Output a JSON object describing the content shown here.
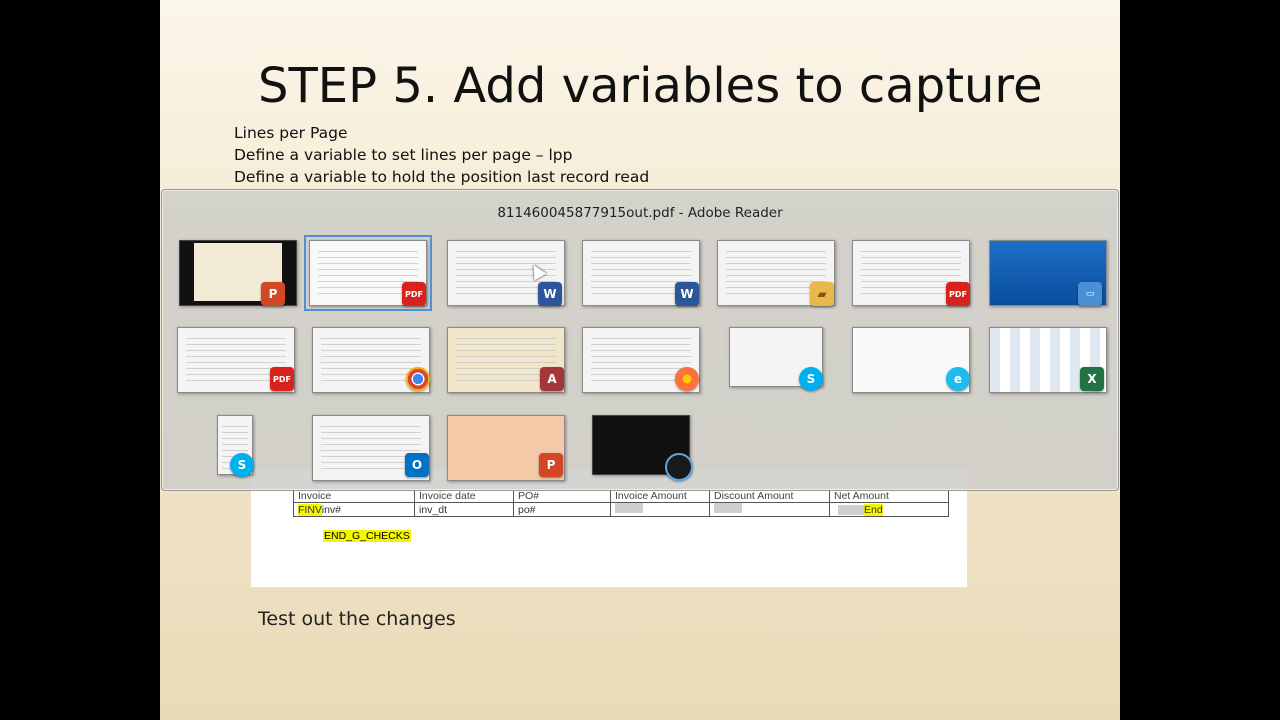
{
  "slide": {
    "title": "STEP 5. Add variables to capture",
    "bullets": [
      "Lines per Page",
      "Define a variable to set lines per page – lpp",
      "Define a variable to hold the position  last record read"
    ],
    "footer": "Test out the changes"
  },
  "document": {
    "headers": [
      "Invoice",
      "Invoice date",
      "PO#",
      "Invoice Amount",
      "Discount Amount",
      "Net Amount"
    ],
    "row": {
      "invoice_prefix": "FINV",
      "invoice_rest": "inv#",
      "invoice_date": "inv_dt",
      "po": "po#",
      "net_amount": "End"
    },
    "end_label": "END_G_CHECKS"
  },
  "switcher": {
    "title": "811460045877915out.pdf - Adobe Reader",
    "windows": [
      {
        "icon": "powerpoint-icon",
        "label": "P"
      },
      {
        "icon": "adobe-pdf-icon",
        "label": "PDF",
        "selected": true
      },
      {
        "icon": "word-icon",
        "label": "W"
      },
      {
        "icon": "word-icon",
        "label": "W"
      },
      {
        "icon": "folder-icon",
        "label": "▰"
      },
      {
        "icon": "adobe-pdf-icon",
        "label": "PDF"
      },
      {
        "icon": "desktop-icon",
        "label": "▭"
      },
      {
        "icon": "adobe-pdf-icon",
        "label": "PDF"
      },
      {
        "icon": "chrome-icon",
        "label": ""
      },
      {
        "icon": "access-icon",
        "label": "A"
      },
      {
        "icon": "firefox-icon",
        "label": ""
      },
      {
        "icon": "skype-icon",
        "label": "S"
      },
      {
        "icon": "internet-explorer-icon",
        "label": "e"
      },
      {
        "icon": "excel-icon",
        "label": "X"
      },
      {
        "icon": "skype-icon",
        "label": "S"
      },
      {
        "icon": "outlook-icon",
        "label": "O"
      },
      {
        "icon": "powerpoint-icon",
        "label": "P"
      },
      {
        "icon": "cortana-icon",
        "label": ""
      }
    ]
  },
  "colors": {
    "highlight": "#f5f500",
    "selection": "#4f8fd8"
  }
}
